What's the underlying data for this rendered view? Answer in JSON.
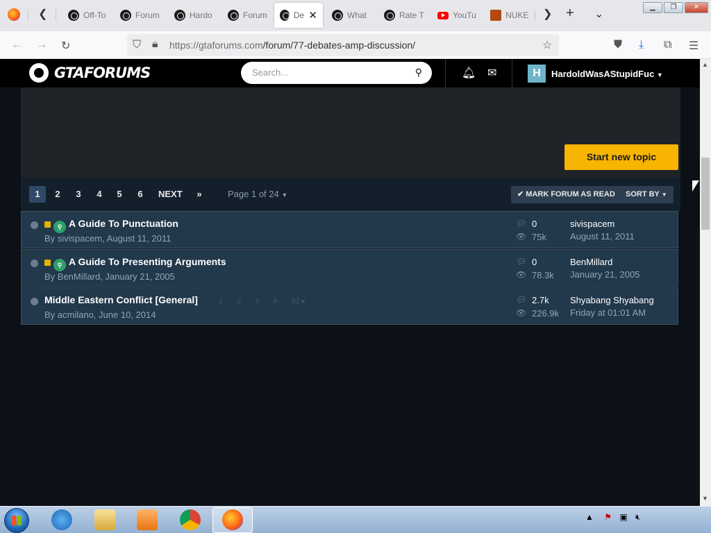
{
  "browser": {
    "tabs": [
      {
        "label": "Off-To",
        "icon": "gtaforums-favicon"
      },
      {
        "label": "Forum",
        "icon": "gtaforums-favicon"
      },
      {
        "label": "Hardo",
        "icon": "gtaforums-favicon"
      },
      {
        "label": "Forum",
        "icon": "gtaforums-favicon"
      },
      {
        "label": "Del",
        "icon": "gtaforums-favicon",
        "active": true
      },
      {
        "label": "What",
        "icon": "gtaforums-favicon"
      },
      {
        "label": "Rate T",
        "icon": "gtaforums-favicon"
      },
      {
        "label": "YouTu",
        "icon": "youtube-favicon"
      },
      {
        "label": "NUKE",
        "icon": "nuke-favicon"
      }
    ],
    "url_host": "https://gtaforums.com",
    "url_path": "/forum/77-debates-amp-discussion/"
  },
  "site": {
    "logo_text": "GTAFORUMS",
    "search_placeholder": "Search...",
    "avatar_letter": "H",
    "username": "HardoldWasAStupidFuc"
  },
  "actions": {
    "start_new_topic": "Start new topic",
    "mark_read": "MARK FORUM AS READ",
    "sort_by": "SORT BY"
  },
  "pagination": {
    "pages": [
      "1",
      "2",
      "3",
      "4",
      "5",
      "6"
    ],
    "current": "1",
    "next": "NEXT",
    "last": "»",
    "page_of": "Page 1 of 24"
  },
  "topics": [
    {
      "title": "A Guide To Punctuation",
      "author_line": "By sivispacem, August 11, 2011",
      "locked": true,
      "pinned": true,
      "replies": "0",
      "views": "75k",
      "last_user": "sivispacem",
      "last_date": "August 11, 2011",
      "mini_pages": []
    },
    {
      "title": "A Guide To Presenting Arguments",
      "author_line": "By BenMillard, January 21, 2005",
      "locked": true,
      "pinned": true,
      "replies": "0",
      "views": "78.3k",
      "last_user": "BenMillard",
      "last_date": "January 21, 2005",
      "mini_pages": []
    },
    {
      "title": "Middle Eastern Conflict [General]",
      "author_line": "By acmilano, June 10, 2014",
      "replies": "2.7k",
      "views": "226.9k",
      "last_user": "Shyabang Shyabang",
      "last_date": "Friday at 01:01 AM",
      "mini_pages": [
        "1",
        "2",
        "3",
        "4",
        "92 ▸"
      ]
    }
  ]
}
